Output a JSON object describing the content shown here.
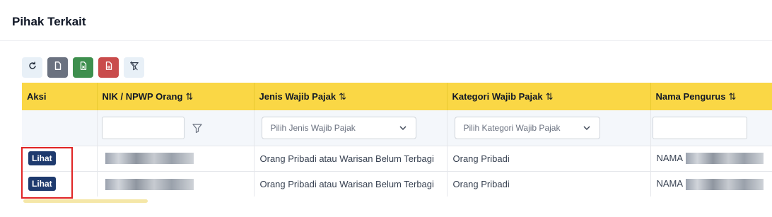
{
  "page": {
    "title": "Pihak Terkait"
  },
  "toolbar": {
    "buttons": [
      {
        "name": "refresh",
        "icon": "refresh-icon"
      },
      {
        "name": "export-csv",
        "icon": "file-icon"
      },
      {
        "name": "export-excel",
        "icon": "excel-icon"
      },
      {
        "name": "export-pdf",
        "icon": "pdf-icon"
      },
      {
        "name": "clear-filter",
        "icon": "filter-clear-icon"
      }
    ]
  },
  "table": {
    "columns": [
      {
        "key": "aksi",
        "label": "Aksi",
        "sortable": false
      },
      {
        "key": "nik",
        "label": "NIK / NPWP Orang",
        "sortable": true
      },
      {
        "key": "jenis",
        "label": "Jenis Wajib Pajak",
        "sortable": true
      },
      {
        "key": "kategori",
        "label": "Kategori Wajib Pajak",
        "sortable": true
      },
      {
        "key": "nama",
        "label": "Nama Pengurus",
        "sortable": true
      }
    ],
    "sort_icon": "⇅",
    "filters": {
      "nik_value": "",
      "jenis_placeholder": "Pilih Jenis Wajib Pajak",
      "kategori_placeholder": "Pilih Kategori Wajib Pajak",
      "nama_value": ""
    },
    "rows": [
      {
        "action": "Lihat",
        "nik": "[redacted]",
        "jenis": "Orang Pribadi atau Warisan Belum Terbagi",
        "kategori": "Orang Pribadi",
        "nama_prefix": "NAMA"
      },
      {
        "action": "Lihat",
        "nik": "[redacted]",
        "jenis": "Orang Pribadi atau Warisan Belum Terbagi",
        "kategori": "Orang Pribadi",
        "nama_prefix": "NAMA"
      }
    ]
  },
  "colors": {
    "header_bg": "#fad745",
    "action_button": "#1e3a6e",
    "highlight": "#e02424",
    "excel": "#3e8f4e",
    "pdf": "#c94b4b"
  }
}
